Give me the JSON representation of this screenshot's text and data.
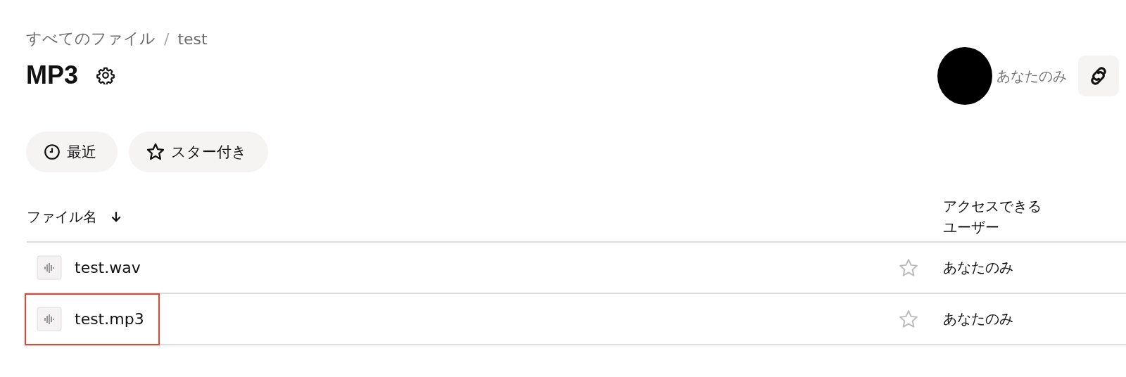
{
  "breadcrumb": [
    {
      "label": "すべてのファイル"
    },
    {
      "label": "test"
    }
  ],
  "breadcrumb_separator": "/",
  "title": "MP3",
  "sharing": {
    "label": "あなたのみ"
  },
  "filters": [
    {
      "label": "最近",
      "kind": "clock"
    },
    {
      "label": "スター付き",
      "kind": "star"
    }
  ],
  "table": {
    "columns": [
      {
        "label": "ファイル名",
        "sort_descending": true
      },
      {
        "label": "アクセスできるユーザー"
      }
    ],
    "rows": [
      {
        "name": "test.wav",
        "starred": false,
        "access": "あなたのみ",
        "highlighted": false
      },
      {
        "name": "test.mp3",
        "starred": false,
        "access": "あなたのみ",
        "highlighted": true
      }
    ]
  }
}
